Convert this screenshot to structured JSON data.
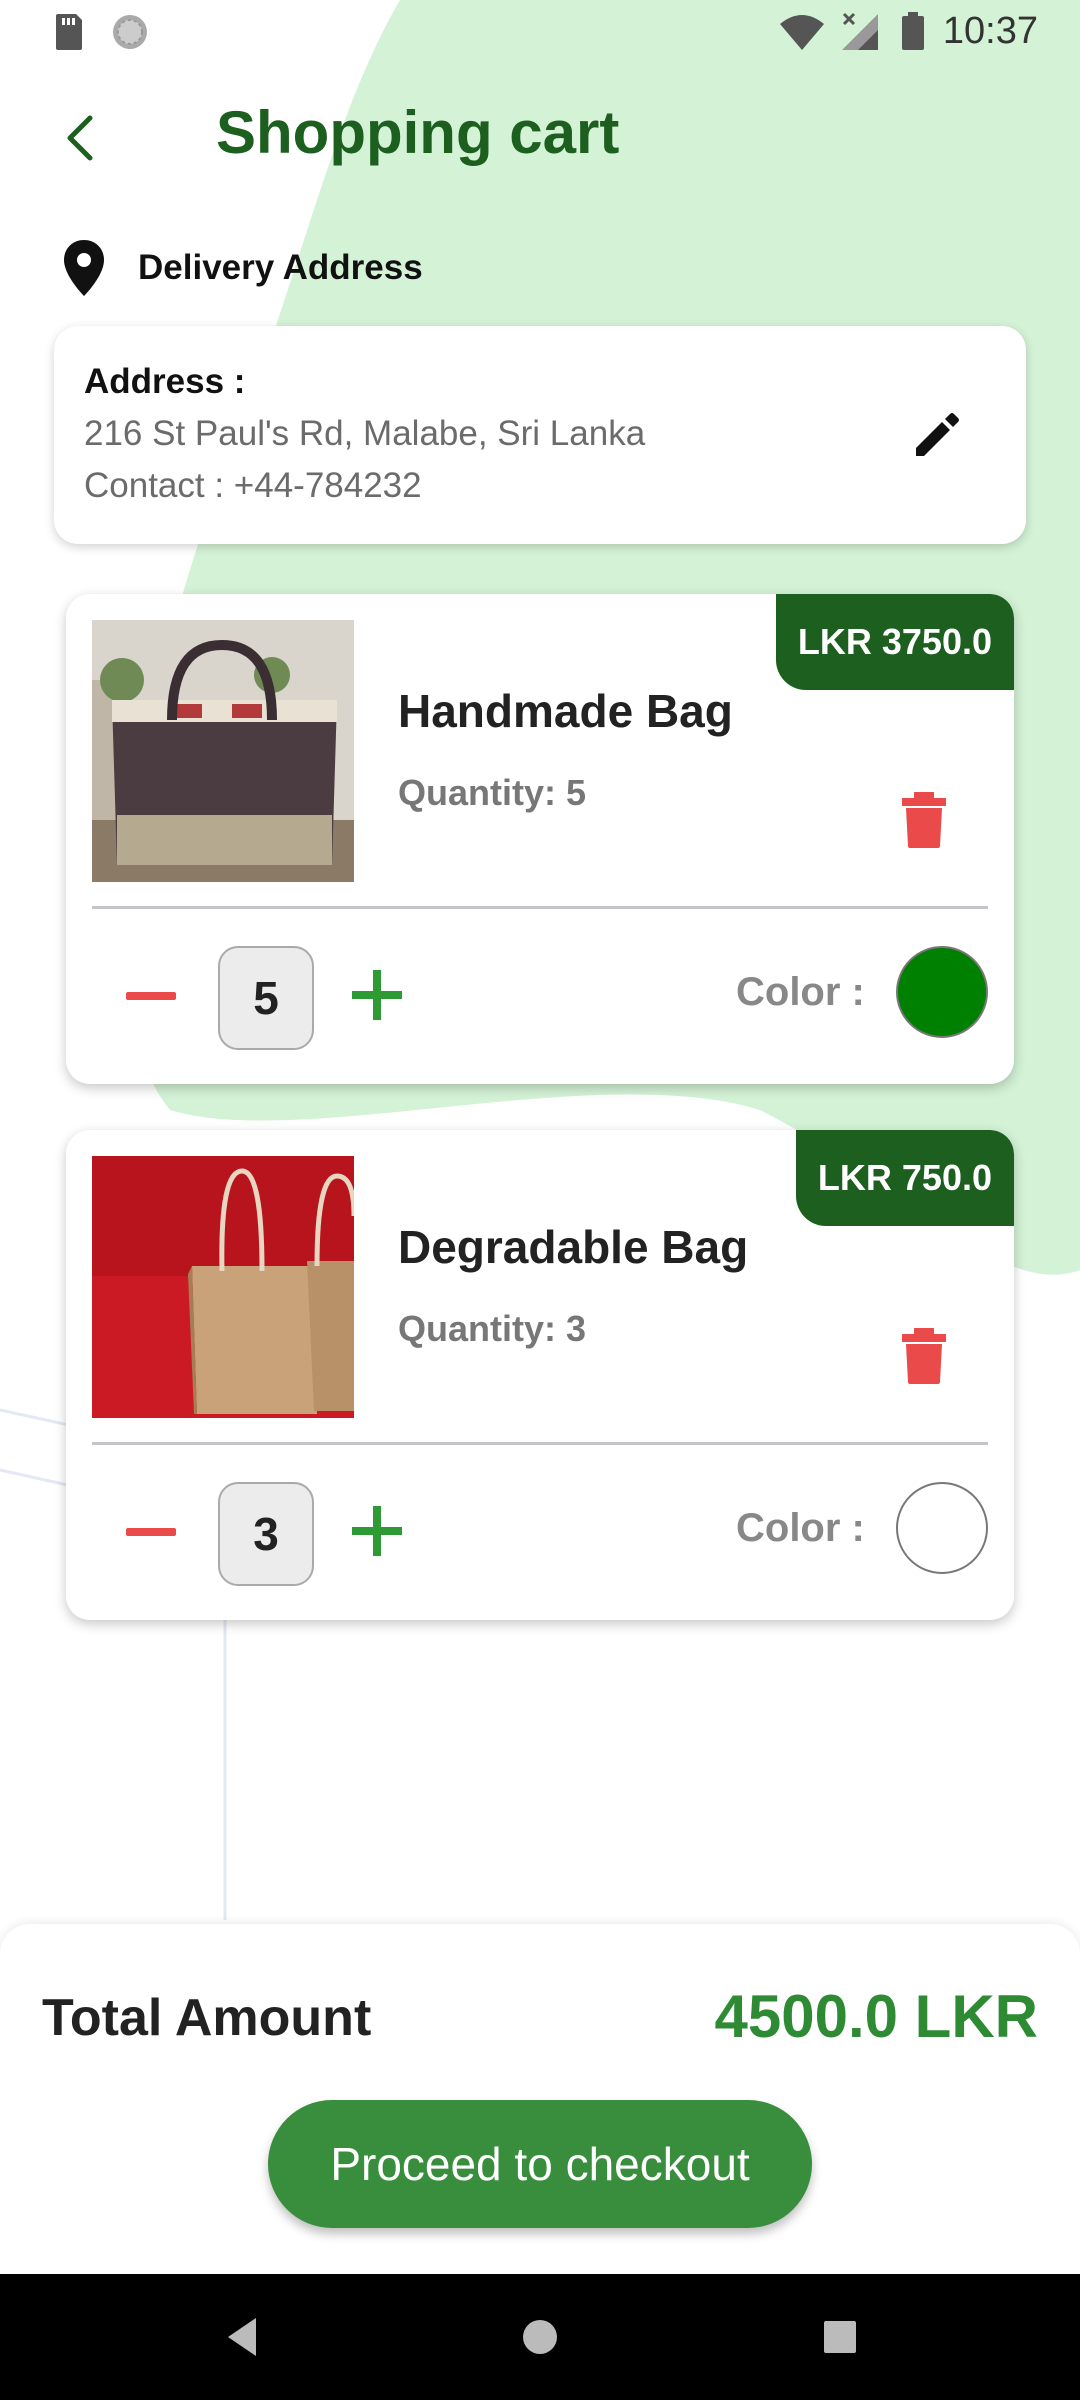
{
  "status_bar": {
    "time": "10:37"
  },
  "header": {
    "title": "Shopping cart"
  },
  "delivery": {
    "label": "Delivery Address",
    "address_title": "Address :",
    "address_line": "216 St Paul's Rd, Malabe, Sri Lanka",
    "contact_line": "Contact : +44-784232"
  },
  "items": [
    {
      "name": "Handmade Bag",
      "price": "LKR 3750.0",
      "quantity_label": "Quantity: 5",
      "quantity": "5",
      "color_label": "Color :",
      "color": "#008000"
    },
    {
      "name": "Degradable Bag",
      "price": "LKR 750.0",
      "quantity_label": "Quantity: 3",
      "quantity": "3",
      "color_label": "Color :",
      "color": "#ffffff"
    }
  ],
  "footer": {
    "total_label": "Total Amount",
    "total_value": "4500.0 LKR",
    "checkout_label": "Proceed to checkout"
  },
  "colors": {
    "primary_dark": "#1c5f1f",
    "primary": "#388e3c",
    "total_green": "#2e8b34",
    "delete_red": "#ea4a4a",
    "background_blob": "#d4f2d6"
  }
}
